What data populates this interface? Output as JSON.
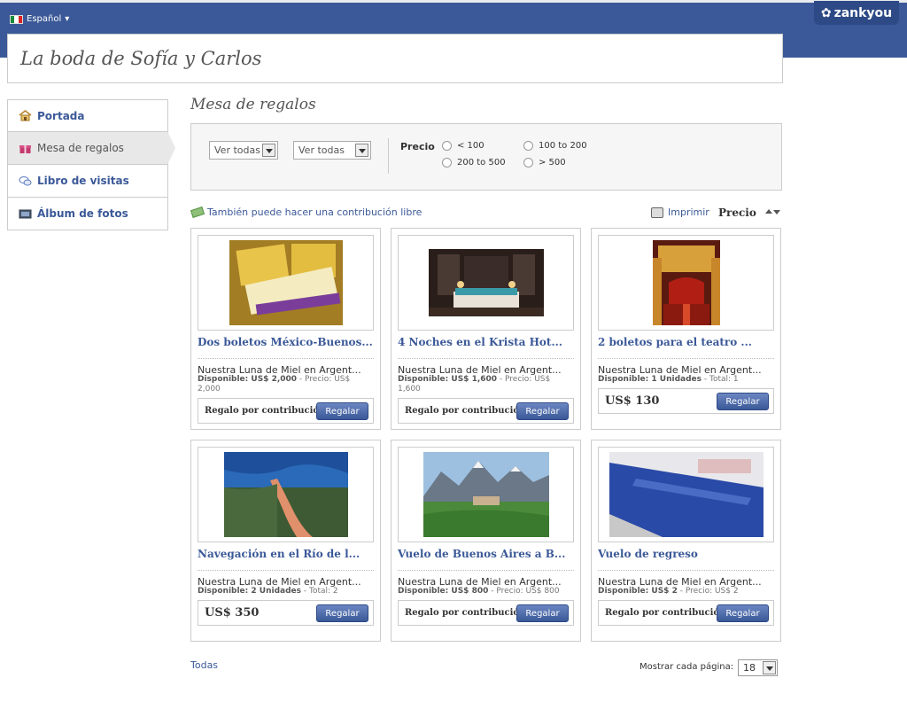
{
  "header": {
    "language": "Español",
    "brand": "zankyou",
    "colors": {
      "header_bg": "#3b5998",
      "link": "#3b5998"
    }
  },
  "page_title": "La boda de Sofía y Carlos",
  "nav": {
    "items": [
      {
        "label": "Portada",
        "icon": "house-icon"
      },
      {
        "label": "Mesa de regalos",
        "icon": "gift-icon"
      },
      {
        "label": "Libro de visitas",
        "icon": "speech-bubbles-icon"
      },
      {
        "label": "Álbum de fotos",
        "icon": "photo-album-icon"
      }
    ],
    "active": "Mesa de regalos"
  },
  "section_title": "Mesa de regalos",
  "filters": {
    "select1": "Ver todas",
    "select2": "Ver todas",
    "price_label": "Precio",
    "price_options": [
      "< 100",
      "100 to 200",
      "200 to 500",
      "> 500"
    ]
  },
  "contribution_link": "También puede hacer una contribución libre",
  "print_label": "Imprimir",
  "sort_label": "Precio",
  "gifts": [
    {
      "name": "Dos boletos México-Buenos...",
      "desc": "Nuestra Luna de Miel en Argent...",
      "avail_label": "Disponible: US$ 2,000",
      "avail_rest": " - Precio: US$ 2,000",
      "action": "Regalo por contribución",
      "button": "Regalar",
      "image": "tickets-photo"
    },
    {
      "name": "4 Noches en el Krista Hot...",
      "desc": "Nuestra Luna de Miel en Argent...",
      "avail_label": "Disponible: US$ 1,600",
      "avail_rest": " - Precio: US$ 1,600",
      "action": "Regalo por contribución",
      "button": "Regalar",
      "image": "hotel-room-photo"
    },
    {
      "name": "2 boletos para el teatro ...",
      "desc": "Nuestra Luna de Miel en Argent...",
      "avail_label": "Disponible: 1 Unidades",
      "avail_rest": " - Total: 1",
      "price": "US$ 130",
      "button": "Regalar",
      "image": "theater-photo"
    },
    {
      "name": "Navegación en el Río de l...",
      "desc": "Nuestra Luna de Miel en Argent...",
      "avail_label": "Disponible: 2 Unidades",
      "avail_rest": " - Total: 2",
      "price": "US$ 350",
      "button": "Regalar",
      "image": "river-aerial-photo"
    },
    {
      "name": "Vuelo de Buenos Aires a B...",
      "desc": "Nuestra Luna de Miel en Argent...",
      "avail_label": "Disponible: US$ 800",
      "avail_rest": " - Precio: US$ 800",
      "action": "Regalo por contribución",
      "button": "Regalar",
      "image": "mountain-lake-photo"
    },
    {
      "name": "Vuelo de regreso",
      "desc": "Nuestra Luna de Miel en Argent...",
      "avail_label": "Disponible: US$ 2",
      "avail_rest": " - Precio: US$ 2",
      "action": "Regalo por contribución",
      "button": "Regalar",
      "image": "boarding-pass-photo"
    }
  ],
  "footer": {
    "all_link": "Todas",
    "per_page_label": "Mostrar cada página:",
    "per_page_value": "18"
  }
}
